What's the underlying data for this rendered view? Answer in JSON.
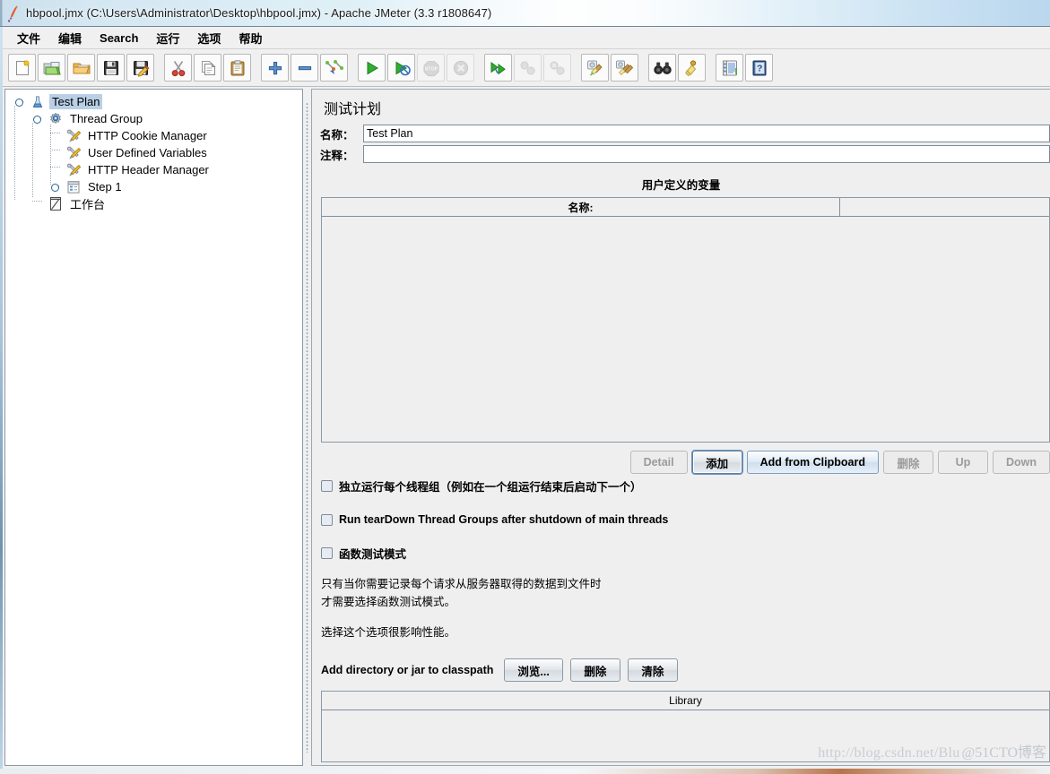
{
  "window": {
    "title": "hbpool.jmx (C:\\Users\\Administrator\\Desktop\\hbpool.jmx) - Apache JMeter (3.3 r1808647)",
    "app_icon": "jmeter-feather-icon"
  },
  "menubar": {
    "items": [
      {
        "label": "文件",
        "name": "menu-file"
      },
      {
        "label": "编辑",
        "name": "menu-edit"
      },
      {
        "label": "Search",
        "name": "menu-search"
      },
      {
        "label": "运行",
        "name": "menu-run"
      },
      {
        "label": "选项",
        "name": "menu-options"
      },
      {
        "label": "帮助",
        "name": "menu-help"
      }
    ]
  },
  "toolbar": {
    "buttons": [
      {
        "icon": "new-document-icon",
        "name": "toolbar-new",
        "enabled": true
      },
      {
        "icon": "templates-icon",
        "name": "toolbar-templates",
        "enabled": true
      },
      {
        "icon": "open-folder-icon",
        "name": "toolbar-open",
        "enabled": true
      },
      {
        "icon": "save-floppy-icon",
        "name": "toolbar-save",
        "enabled": true
      },
      {
        "icon": "save-as-icon",
        "name": "toolbar-save-as",
        "enabled": true
      },
      {
        "icon": "scissors-icon",
        "name": "toolbar-cut",
        "enabled": true
      },
      {
        "icon": "copy-icon",
        "name": "toolbar-copy",
        "enabled": true
      },
      {
        "icon": "clipboard-paste-icon",
        "name": "toolbar-paste",
        "enabled": true
      },
      {
        "icon": "plus-icon",
        "name": "toolbar-expand-all",
        "enabled": true
      },
      {
        "icon": "minus-icon",
        "name": "toolbar-collapse-all",
        "enabled": true
      },
      {
        "icon": "toggle-icon",
        "name": "toolbar-toggle",
        "enabled": true
      },
      {
        "icon": "play-icon",
        "name": "toolbar-start",
        "enabled": true
      },
      {
        "icon": "play-no-pause-icon",
        "name": "toolbar-start-no-pauses",
        "enabled": true
      },
      {
        "icon": "stop-icon",
        "name": "toolbar-stop",
        "enabled": false
      },
      {
        "icon": "shutdown-icon",
        "name": "toolbar-shutdown",
        "enabled": false
      },
      {
        "icon": "remote-start-icon",
        "name": "toolbar-remote-start-all",
        "enabled": true
      },
      {
        "icon": "remote-stop-icon",
        "name": "toolbar-remote-stop-all",
        "enabled": false
      },
      {
        "icon": "remote-shutdown-icon",
        "name": "toolbar-remote-shutdown-all",
        "enabled": false
      },
      {
        "icon": "clear-broom-icon",
        "name": "toolbar-clear",
        "enabled": true
      },
      {
        "icon": "clear-all-broom-icon",
        "name": "toolbar-clear-all",
        "enabled": true
      },
      {
        "icon": "binoculars-icon",
        "name": "toolbar-search",
        "enabled": true
      },
      {
        "icon": "reset-search-brush-icon",
        "name": "toolbar-reset-search",
        "enabled": true
      },
      {
        "icon": "function-helper-icon",
        "name": "toolbar-function-helper",
        "enabled": true
      },
      {
        "icon": "help-book-icon",
        "name": "toolbar-help",
        "enabled": true
      }
    ]
  },
  "tree": {
    "nodes": [
      {
        "label": "Test Plan",
        "icon": "test-plan-icon",
        "depth": 0,
        "selected": true,
        "expandable": true,
        "expanded": true
      },
      {
        "label": "Thread Group",
        "icon": "thread-group-icon",
        "depth": 1,
        "selected": false,
        "expandable": true,
        "expanded": true
      },
      {
        "label": "HTTP Cookie Manager",
        "icon": "config-tools-icon",
        "depth": 2,
        "selected": false,
        "expandable": false,
        "expanded": false
      },
      {
        "label": "User Defined Variables",
        "icon": "config-tools-icon",
        "depth": 2,
        "selected": false,
        "expandable": false,
        "expanded": false
      },
      {
        "label": "HTTP Header Manager",
        "icon": "config-tools-icon",
        "depth": 2,
        "selected": false,
        "expandable": false,
        "expanded": false
      },
      {
        "label": "Step 1",
        "icon": "controller-icon",
        "depth": 2,
        "selected": false,
        "expandable": true,
        "expanded": false
      },
      {
        "label": "工作台",
        "icon": "workbench-icon",
        "depth": 1,
        "selected": false,
        "expandable": false,
        "expanded": false
      }
    ]
  },
  "main": {
    "panel_title": "测试计划",
    "name_label": "名称：",
    "name_value": "Test Plan",
    "comment_label": "注释：",
    "comment_value": "",
    "udv": {
      "title": "用户定义的变量",
      "columns": [
        "名称:",
        ""
      ],
      "rows": []
    },
    "table_buttons": [
      {
        "label": "Detail",
        "name": "detail-button",
        "enabled": false,
        "accent": false,
        "focused": false
      },
      {
        "label": "添加",
        "name": "add-button",
        "enabled": true,
        "accent": false,
        "focused": true
      },
      {
        "label": "Add from Clipboard",
        "name": "add-from-clipboard-button",
        "enabled": true,
        "accent": true,
        "focused": false
      },
      {
        "label": "删除",
        "name": "delete-button",
        "enabled": false,
        "accent": false,
        "focused": false
      },
      {
        "label": "Up",
        "name": "up-button",
        "enabled": false,
        "accent": false,
        "focused": false
      },
      {
        "label": "Down",
        "name": "down-button",
        "enabled": false,
        "accent": false,
        "focused": false
      }
    ],
    "checkboxes": [
      {
        "label": "独立运行每个线程组（例如在一个组运行结束后启动下一个）",
        "name": "serialize-threadgroups-checkbox",
        "checked": false
      },
      {
        "label": "Run tearDown Thread Groups after shutdown of main threads",
        "name": "run-teardown-checkbox",
        "checked": false
      },
      {
        "label": "函数测试模式",
        "name": "functional-test-mode-checkbox",
        "checked": false
      }
    ],
    "help_line1": "只有当你需要记录每个请求从服务器取得的数据到文件时",
    "help_line2": "才需要选择函数测试模式。",
    "help_line3": "选择这个选项很影响性能。",
    "classpath": {
      "label": "Add directory or jar to classpath",
      "buttons": [
        {
          "label": "浏览...",
          "name": "browse-button"
        },
        {
          "label": "删除",
          "name": "classpath-delete-button"
        },
        {
          "label": "清除",
          "name": "classpath-clear-button"
        }
      ]
    },
    "library": {
      "header": "Library",
      "rows": []
    }
  },
  "watermark": {
    "url": "http://blog.csdn.net/Blu",
    "tag": "@51CTO博客"
  },
  "colors": {
    "selection": "#b8cfe5",
    "panel_bg": "#efefef",
    "tree_bg": "#ffffff",
    "border": "#8a99a8",
    "accent": "#2a6496"
  }
}
